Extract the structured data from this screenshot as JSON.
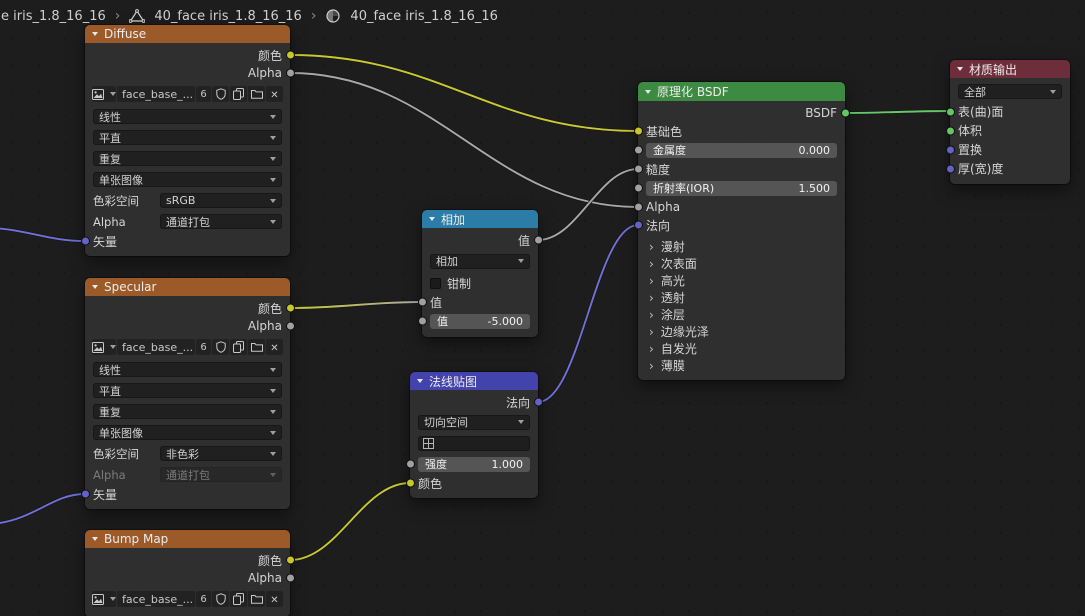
{
  "breadcrumb": {
    "separator": "›",
    "items": [
      "e iris_1.8_16_16",
      "40_face iris_1.8_16_16",
      "40_face iris_1.8_16_16"
    ]
  },
  "diffuse": {
    "title": "Diffuse",
    "out_color": "颜色",
    "out_alpha": "Alpha",
    "image_name": "face_base_...",
    "image_users": "6",
    "interpolation": "线性",
    "projection": "平直",
    "extension": "重复",
    "source": "单张图像",
    "colorspace_label": "色彩空间",
    "colorspace": "sRGB",
    "alpha_label": "Alpha",
    "alpha_mode": "通道打包",
    "in_vector": "矢量"
  },
  "specular": {
    "title": "Specular",
    "out_color": "颜色",
    "out_alpha": "Alpha",
    "image_name": "face_base_...",
    "image_users": "6",
    "interpolation": "线性",
    "projection": "平直",
    "extension": "重复",
    "source": "单张图像",
    "colorspace_label": "色彩空间",
    "colorspace": "非色彩",
    "alpha_label": "Alpha",
    "alpha_mode": "通道打包",
    "in_vector": "矢量"
  },
  "bump": {
    "title": "Bump Map",
    "out_color": "颜色",
    "out_alpha": "Alpha",
    "image_name": "face_base_...",
    "image_users": "6"
  },
  "add_node": {
    "title": "相加",
    "out_value": "值",
    "operation": "相加",
    "clamp": "钳制",
    "in_value1": "值",
    "in_value2_label": "值",
    "in_value2": "-5.000"
  },
  "normal_map": {
    "title": "法线贴图",
    "out_normal": "法向",
    "space": "切向空间",
    "strength_label": "强度",
    "strength": "1.000",
    "in_color": "颜色"
  },
  "bsdf": {
    "title": "原理化 BSDF",
    "out_bsdf": "BSDF",
    "in_base_color": "基础色",
    "metallic_label": "金属度",
    "metallic": "0.000",
    "in_roughness": "糙度",
    "ior_label": "折射率(IOR)",
    "ior": "1.500",
    "in_alpha": "Alpha",
    "in_normal": "法向",
    "panels": [
      "漫射",
      "次表面",
      "高光",
      "透射",
      "涂层",
      "边缘光泽",
      "自发光",
      "薄膜"
    ]
  },
  "output_node": {
    "title": "材质输出",
    "target": "全部",
    "in_surface": "表(曲)面",
    "in_volume": "体积",
    "in_displacement": "置换",
    "in_thickness": "厚(宽)度"
  },
  "colors": {
    "background": "#1d1d1d",
    "node_body": "#2f2f2f",
    "header_texture": "#9b5a28",
    "header_converter": "#2b7ca6",
    "header_vector": "#4343ae",
    "header_shader": "#3d8b42",
    "header_output": "#6e2d3a",
    "socket_color": "#c7c729",
    "socket_value": "#a1a1a1",
    "socket_vector": "#6363c7",
    "socket_shader": "#63c763",
    "wire_yellow": "#c8c832",
    "wire_gray": "#a8a8a8",
    "wire_purple": "#7070d8",
    "wire_green": "#68c868"
  }
}
